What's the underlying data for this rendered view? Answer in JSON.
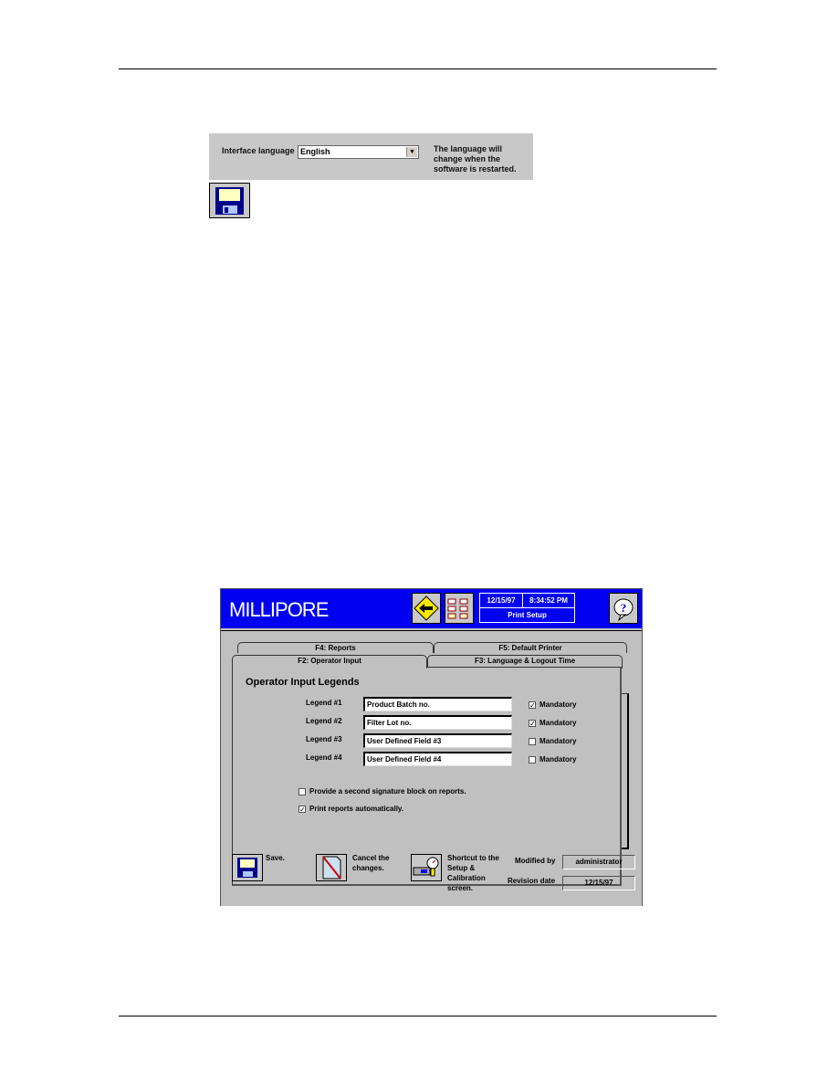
{
  "language_panel": {
    "label": "Interface language",
    "selected": "English",
    "note": "The language will change when the software is restarted."
  },
  "icons": {
    "save": "floppy-disk-icon",
    "back": "yellow-diamond-back-arrow-icon",
    "menu": "menu-grid-icon",
    "help": "question-bubble-icon",
    "cancel": "crossed-document-icon",
    "shortcut": "calibration-gauge-icon"
  },
  "app": {
    "brand": "MILLIPORE",
    "date": "12/15/97",
    "time": "8:34:52 PM",
    "screen": "Print Setup",
    "tabs": {
      "back_row": [
        "F4: Reports",
        "F5: Default Printer"
      ],
      "front_row": [
        "F2: Operator Input",
        "F3: Language & Logout Time"
      ],
      "active": "F2: Operator Input"
    },
    "panel_title": "Operator Input Legends",
    "legends": [
      {
        "label": "Legend #1",
        "value": "Product Batch no.",
        "mandatory": true,
        "mandatory_label": "Mandatory"
      },
      {
        "label": "Legend #2",
        "value": "Filter Lot no.",
        "mandatory": true,
        "mandatory_label": "Mandatory"
      },
      {
        "label": "Legend #3",
        "value": "User Defined Field #3",
        "mandatory": false,
        "mandatory_label": "Mandatory"
      },
      {
        "label": "Legend #4",
        "value": "User Defined Field #4",
        "mandatory": false,
        "mandatory_label": "Mandatory"
      }
    ],
    "options": [
      {
        "label": "Provide a second signature block on reports.",
        "checked": false
      },
      {
        "label": "Print reports automatically.",
        "checked": true
      }
    ],
    "footer": {
      "save_label": "Save.",
      "cancel_label": "Cancel the changes.",
      "shortcut_label": "Shortcut to the Setup & Calibration screen.",
      "modified_by_label": "Modified by",
      "modified_by": "administrator",
      "revision_date_label": "Revision date",
      "revision_date": "12/15/97"
    }
  }
}
